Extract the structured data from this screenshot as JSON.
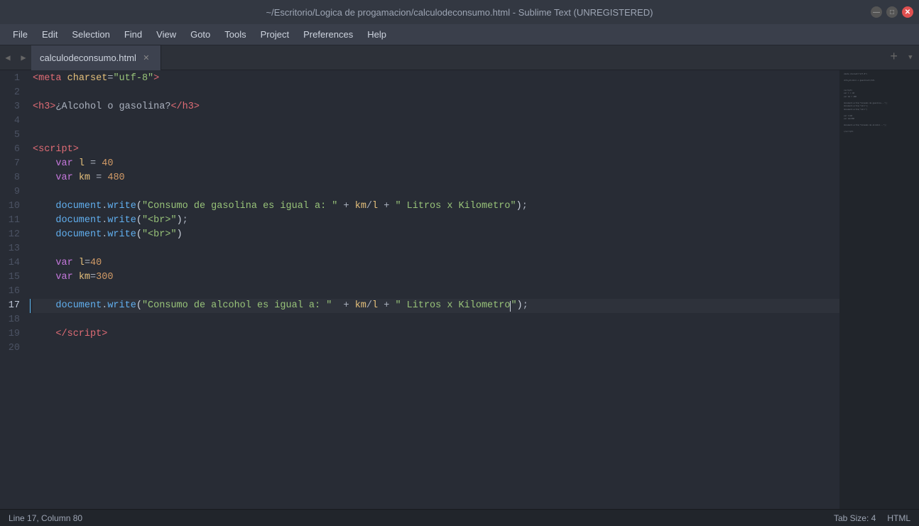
{
  "titlebar": {
    "title": "~/Escritorio/Logica de progamacion/calculodeconsumo.html - Sublime Text (UNREGISTERED)"
  },
  "menubar": {
    "items": [
      "File",
      "Edit",
      "Selection",
      "Find",
      "View",
      "Goto",
      "Tools",
      "Project",
      "Preferences",
      "Help"
    ]
  },
  "tabs": {
    "active": "calculodeconsumo.html",
    "list": [
      {
        "name": "calculodeconsumo.html"
      }
    ],
    "add_label": "+",
    "layout_label": "▾"
  },
  "status": {
    "left": {
      "position": "Line 17, Column 80"
    },
    "right": {
      "tab_size": "Tab Size: 4",
      "syntax": "HTML"
    }
  },
  "lines": {
    "count": 20,
    "active": 17
  }
}
